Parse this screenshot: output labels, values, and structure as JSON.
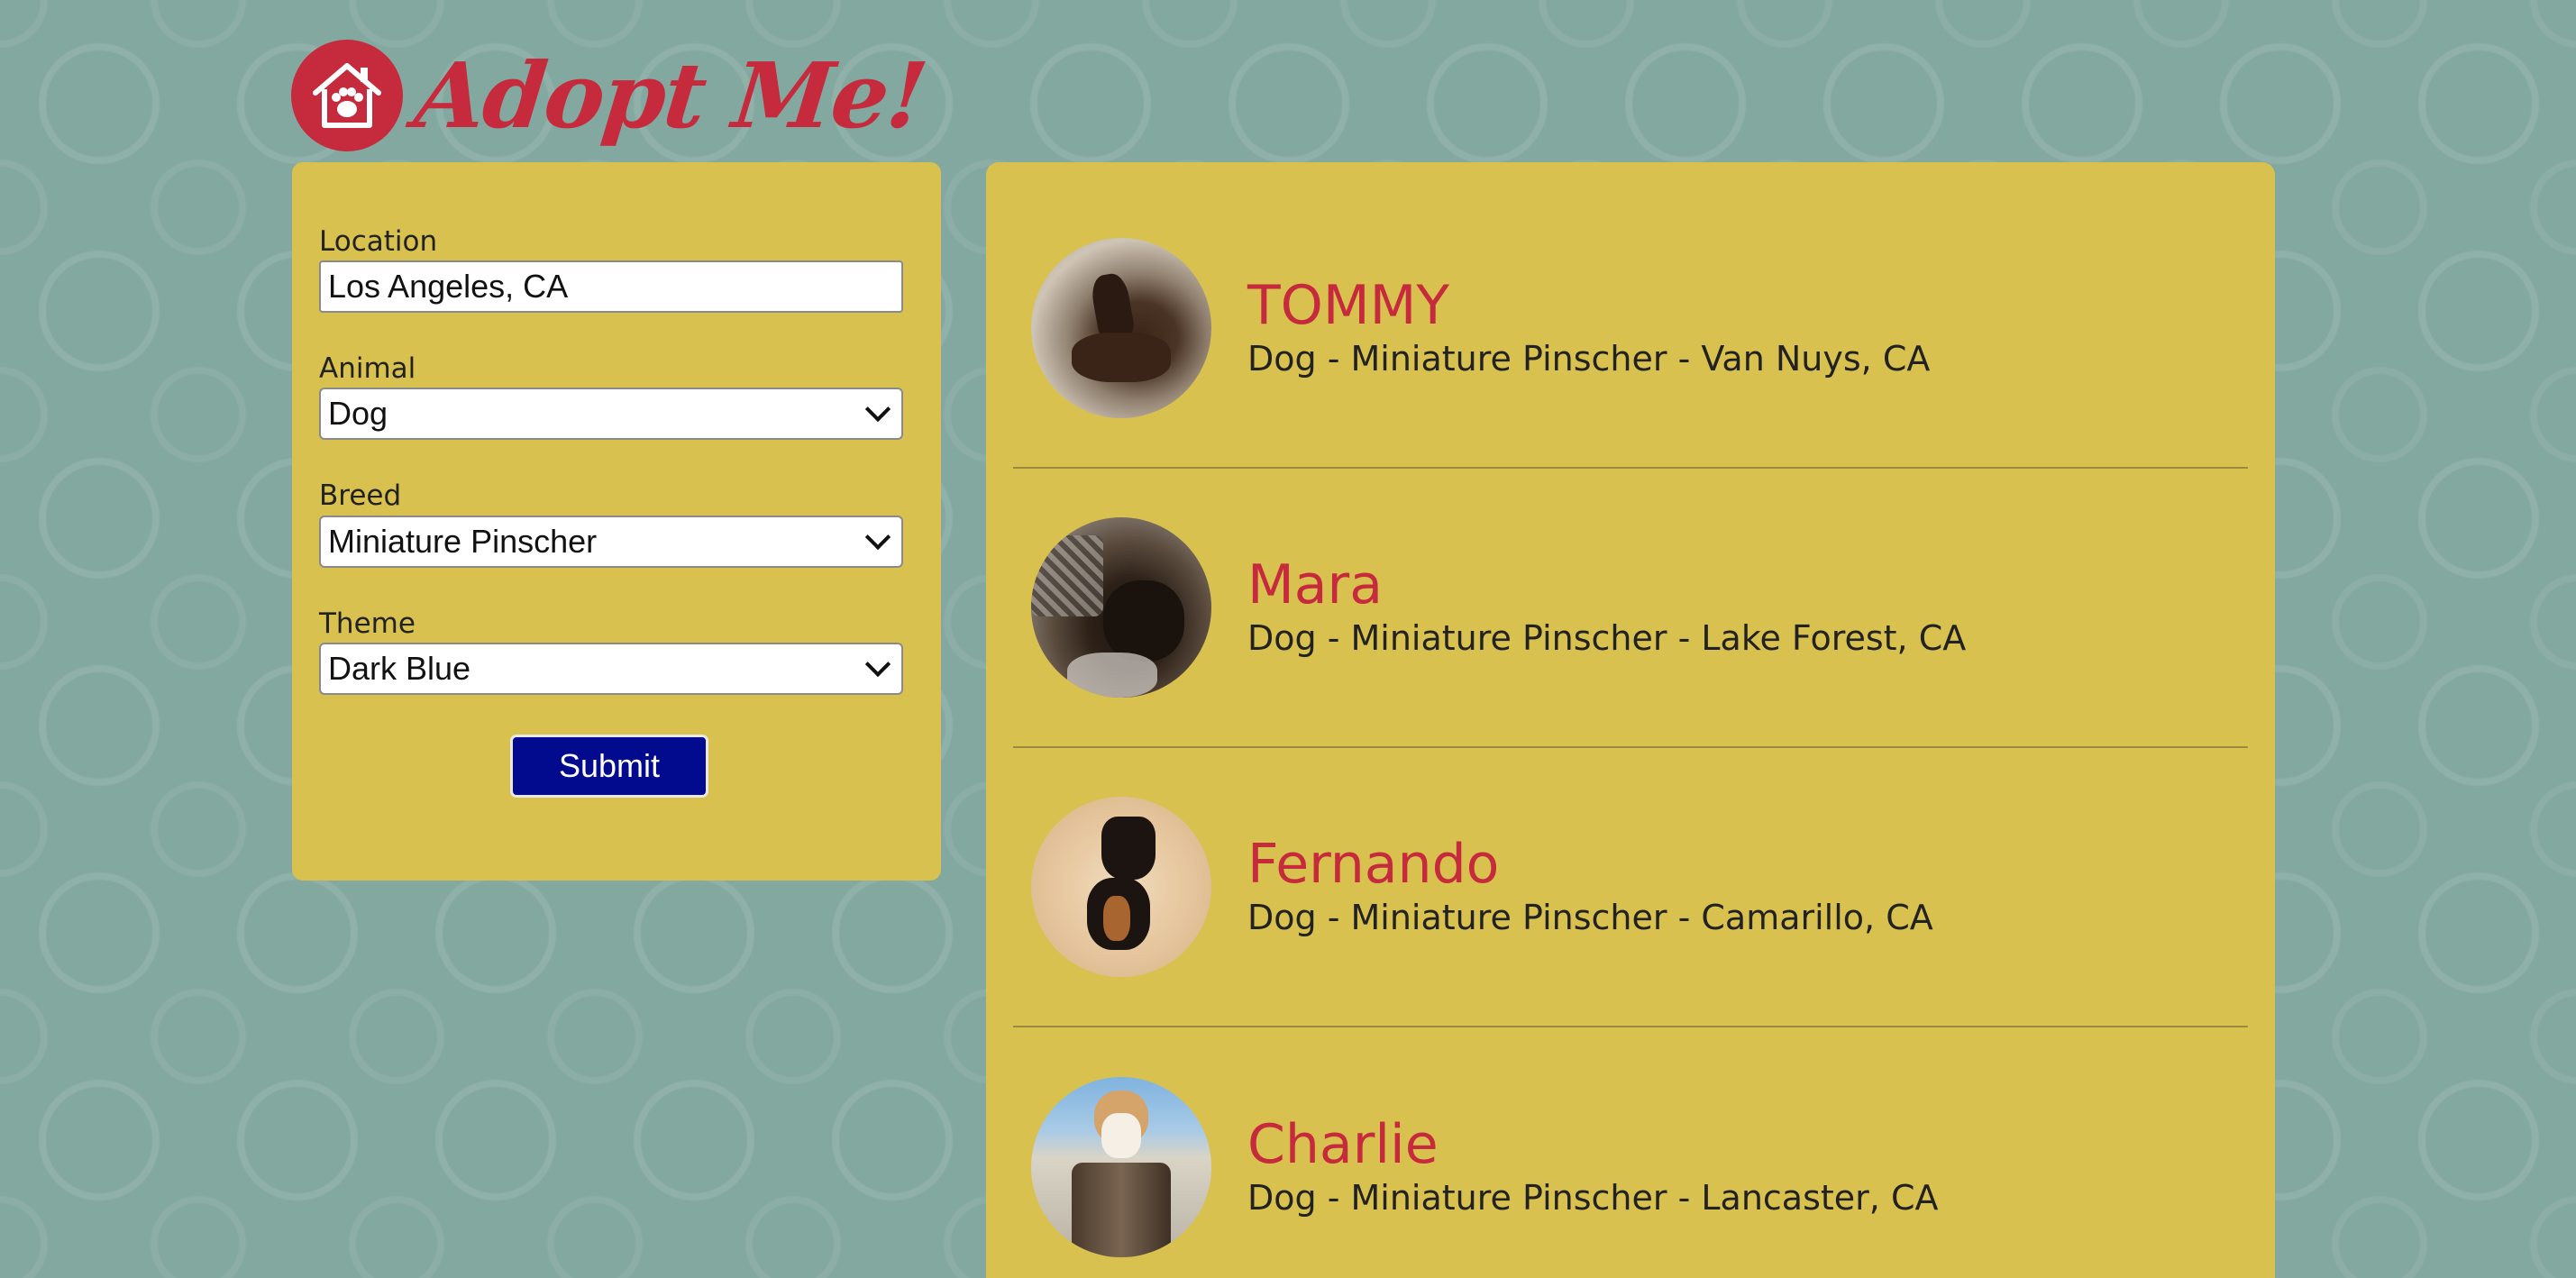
{
  "header": {
    "logo_text": "Adopt Me!"
  },
  "search": {
    "location_label": "Location",
    "location_value": "Los Angeles, CA",
    "animal_label": "Animal",
    "animal_value": "Dog",
    "breed_label": "Breed",
    "breed_value": "Miniature Pinscher",
    "theme_label": "Theme",
    "theme_value": "Dark Blue",
    "submit_label": "Submit"
  },
  "pets": [
    {
      "name": "TOMMY",
      "description": "Dog - Miniature Pinscher - Van Nuys, CA"
    },
    {
      "name": "Mara",
      "description": "Dog - Miniature Pinscher - Lake Forest, CA"
    },
    {
      "name": "Fernando",
      "description": "Dog - Miniature Pinscher - Camarillo, CA"
    },
    {
      "name": "Charlie",
      "description": "Dog - Miniature Pinscher - Lancaster, CA"
    }
  ],
  "colors": {
    "background": "#83a8a0",
    "panel": "#d9c150",
    "accent_red": "#c62a3d",
    "button_blue": "#020b8e"
  },
  "icons": {
    "logo": "house-paw-icon",
    "select_arrow": "chevron-down-icon"
  }
}
